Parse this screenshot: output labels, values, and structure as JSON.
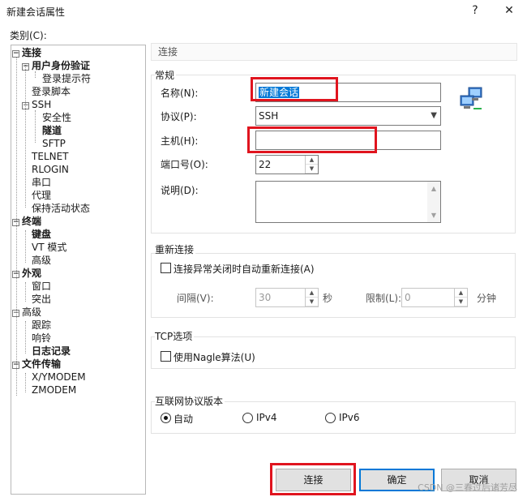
{
  "window": {
    "title": "新建会话属性",
    "help_glyph": "?",
    "close_glyph": "✕"
  },
  "category_label": "类别(C):",
  "tree": {
    "connection": "连接",
    "auth": "用户身份验证",
    "login_prompt": "登录提示符",
    "login_script": "登录脚本",
    "ssh": "SSH",
    "security": "安全性",
    "tunnel": "隧道",
    "sftp": "SFTP",
    "telnet": "TELNET",
    "rlogin": "RLOGIN",
    "serial": "串口",
    "proxy": "代理",
    "keepalive": "保持活动状态",
    "terminal": "终端",
    "keyboard": "键盘",
    "vt_mode": "VT 模式",
    "advanced_term": "高级",
    "appearance": "外观",
    "window": "窗口",
    "highlight": "突出",
    "advanced": "高级",
    "trace": "跟踪",
    "bell": "响铃",
    "logging": "日志记录",
    "file_transfer": "文件传输",
    "xymodem": "X/YMODEM",
    "zmodem": "ZMODEM",
    "expand_minus": "−"
  },
  "panel_title": "连接",
  "general": {
    "group": "常规",
    "name_label": "名称(N):",
    "name_value": "新建会话",
    "protocol_label": "协议(P):",
    "protocol_value": "SSH",
    "host_label": "主机(H):",
    "host_value": "",
    "port_label": "端口号(O):",
    "port_value": "22",
    "desc_label": "说明(D):",
    "desc_value": ""
  },
  "reconnect": {
    "group": "重新连接",
    "checkbox_label": "连接异常关闭时自动重新连接(A)",
    "interval_label": "间隔(V):",
    "interval_value": "30",
    "interval_unit": "秒",
    "limit_label": "限制(L):",
    "limit_value": "0",
    "limit_unit": "分钟"
  },
  "tcp": {
    "group": "TCP选项",
    "nagle_label": "使用Nagle算法(U)"
  },
  "ip_version": {
    "group": "互联网协议版本",
    "options": [
      "自动",
      "IPv4",
      "IPv6"
    ],
    "selected": "自动"
  },
  "buttons": {
    "connect": "连接",
    "ok": "确定",
    "cancel": "取消"
  },
  "watermark": "CSDN @三春过后诸芳尽",
  "colors": {
    "accent": "#0078d7",
    "highlight_box": "#e0141e"
  }
}
